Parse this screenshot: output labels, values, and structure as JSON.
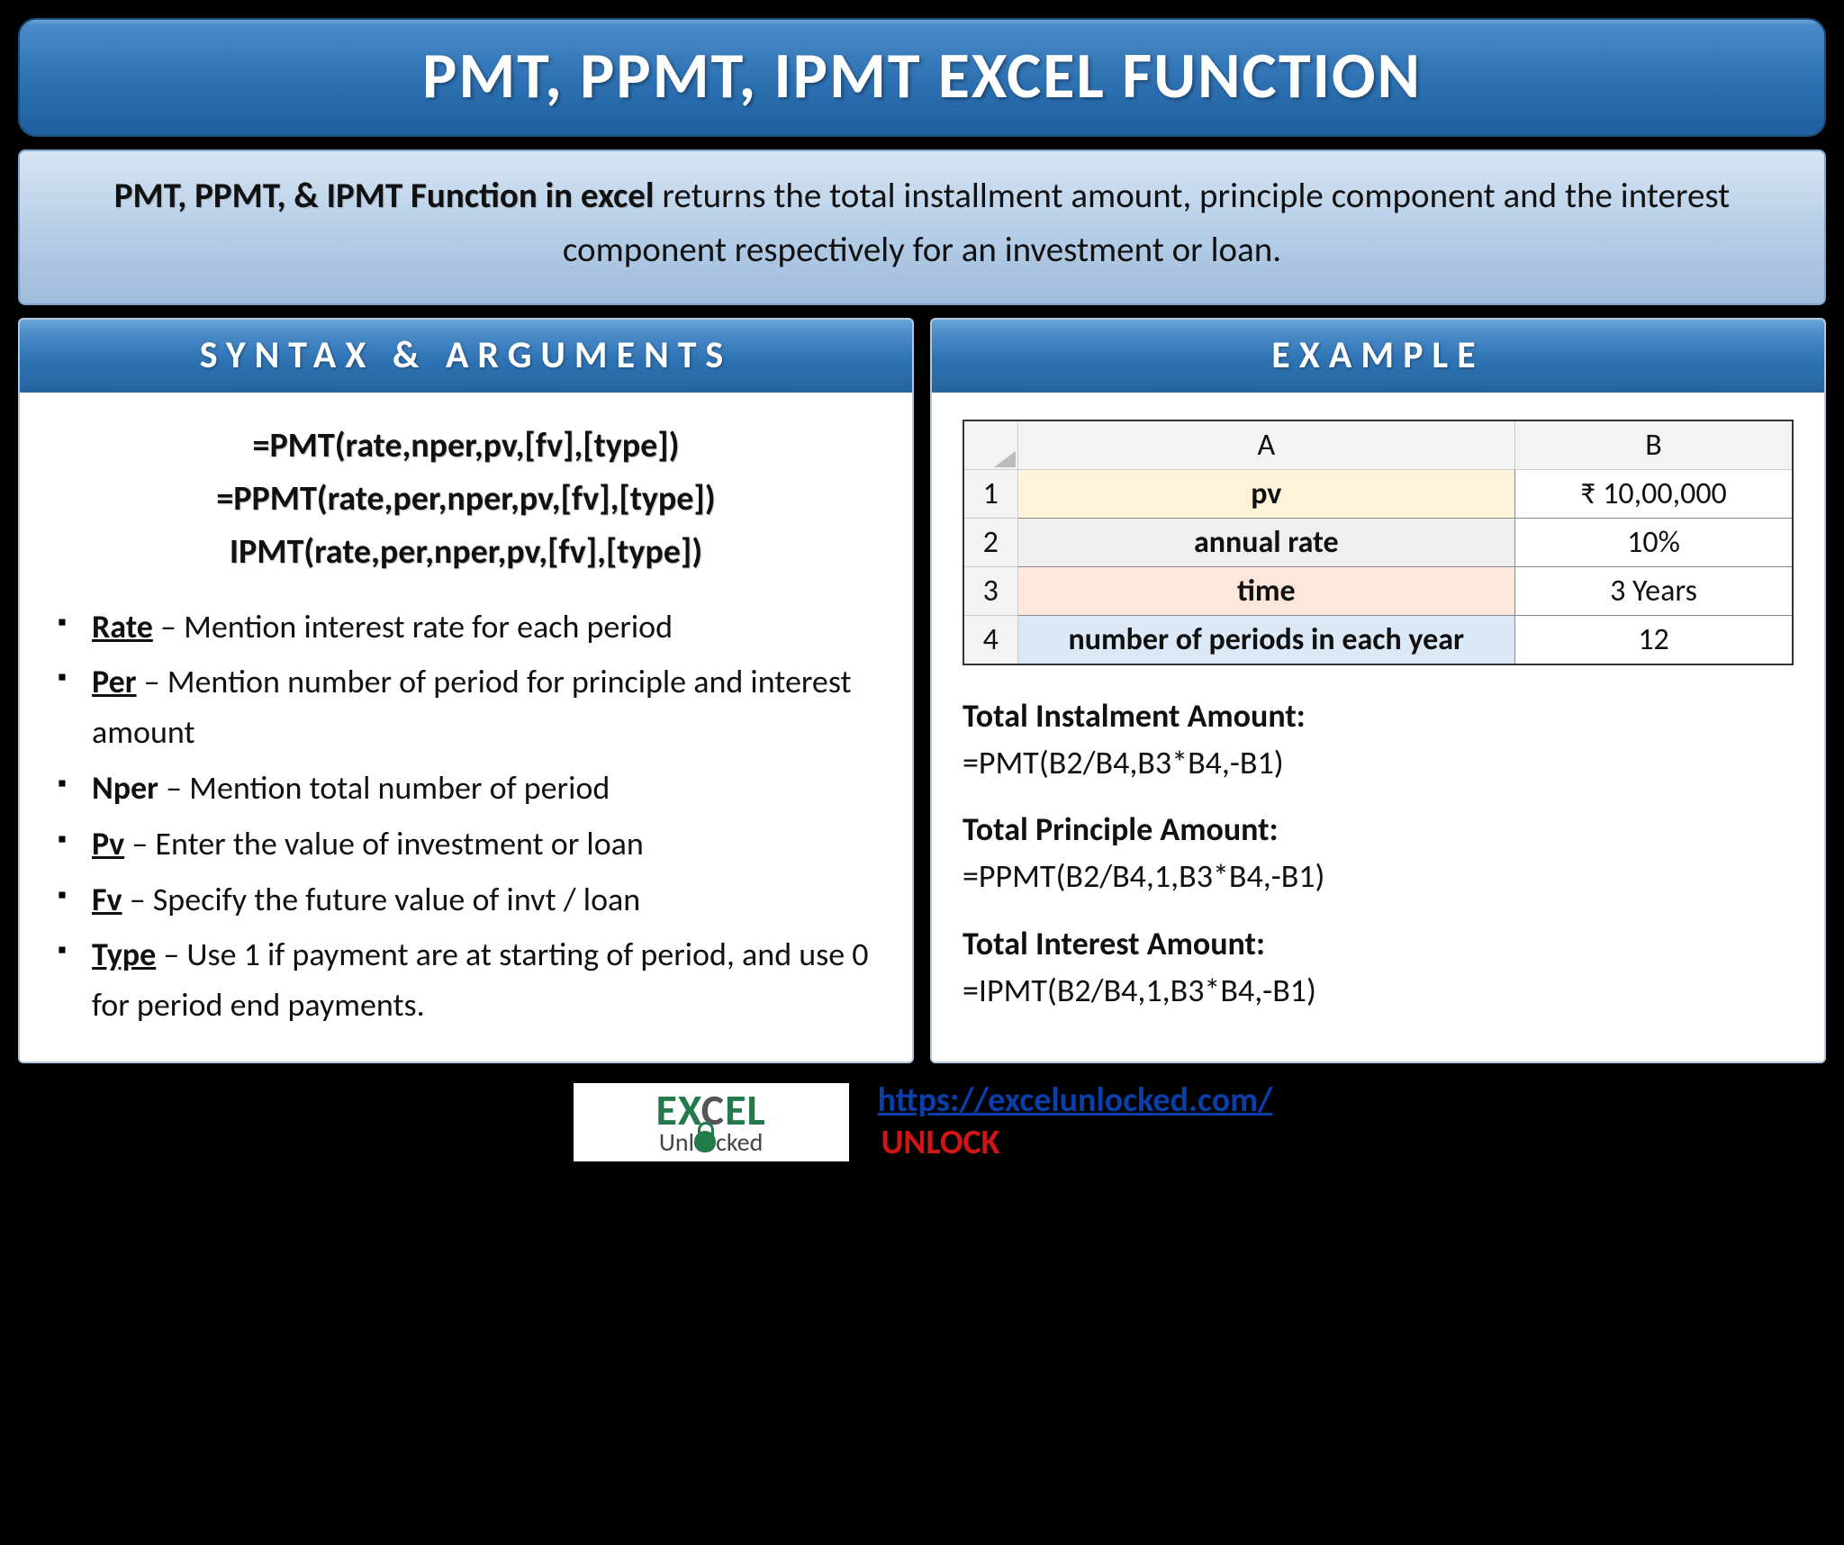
{
  "title": "PMT, PPMT, IPMT EXCEL FUNCTION",
  "subtitle": {
    "bold": "PMT, PPMT, & IPMT Function in excel",
    "rest": " returns the total installment amount, principle component and the interest component respectively for an investment or loan."
  },
  "syntax": {
    "header": "SYNTAX & ARGUMENTS",
    "lines": [
      "=PMT(rate,nper,pv,[fv],[type])",
      "=PPMT(rate,per,nper,pv,[fv],[type])",
      "IPMT(rate,per,nper,pv,[fv],[type])"
    ],
    "args": [
      {
        "name": "Rate",
        "desc": " – Mention interest rate for each period",
        "underline": true
      },
      {
        "name": "Per",
        "desc": " – Mention number of period for principle and interest amount",
        "underline": true
      },
      {
        "name": "Nper",
        "desc": " – Mention total number of period",
        "underline": false
      },
      {
        "name": "Pv",
        "desc": " – Enter the value of investment or loan",
        "underline": true
      },
      {
        "name": "Fv",
        "desc": " – Specify the future value of invt / loan",
        "underline": true
      },
      {
        "name": "Type",
        "desc": " – Use 1 if payment are at starting of period, and use 0 for period end payments.",
        "underline": true
      }
    ]
  },
  "example": {
    "header": "EXAMPLE",
    "colA": "A",
    "colB": "B",
    "rows": [
      {
        "n": "1",
        "label": "pv",
        "value": "₹ 10,00,000"
      },
      {
        "n": "2",
        "label": "annual rate",
        "value": "10%"
      },
      {
        "n": "3",
        "label": "time",
        "value": "3 Years"
      },
      {
        "n": "4",
        "label": "number of periods in each year",
        "value": "12"
      }
    ],
    "results": [
      {
        "title": "Total Instalment Amount:",
        "formula": "=PMT(B2/B4,B3*B4,-B1)"
      },
      {
        "title": "Total Principle Amount:",
        "formula": "=PPMT(B2/B4,1,B3*B4,-B1)"
      },
      {
        "title": "Total Interest Amount:",
        "formula": "=IPMT(B2/B4,1,B3*B4,-B1)"
      }
    ]
  },
  "footer": {
    "logo_main_a": "EX",
    "logo_main_b": "EL",
    "logo_sub_a": "Unl",
    "logo_sub_b": "cked",
    "url": "https://excelunlocked.com/",
    "unlock": "UNLOCK"
  }
}
